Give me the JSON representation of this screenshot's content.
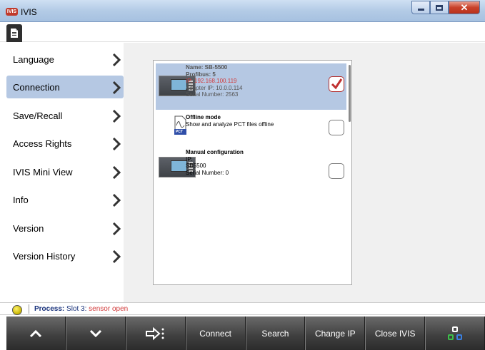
{
  "window": {
    "app_icon_text": "IVIS",
    "title": "IVIS"
  },
  "menubar": {
    "doc_icon": "document-icon"
  },
  "sidebar": {
    "items": [
      {
        "label": "Language"
      },
      {
        "label": "Connection"
      },
      {
        "label": "Save/Recall"
      },
      {
        "label": "Access Rights"
      },
      {
        "label": "IVIS Mini View"
      },
      {
        "label": "Info"
      },
      {
        "label": "Version"
      },
      {
        "label": "Version History"
      }
    ],
    "active_index": 1
  },
  "connection_list": {
    "items": [
      {
        "name": "Name: SB-5500",
        "profibus": "Profibus: 5",
        "ip": "IP: 192.168.100.119",
        "adapter_ip": "Adapter IP: 10.0.0.114",
        "serial": "Serial Number: 2563",
        "checked": true
      },
      {
        "title": "Offline mode",
        "desc": "Show and analyze PCT files offline",
        "icon_label": "PCT",
        "checked": false
      },
      {
        "title": "Manual configuration",
        "ip": "IP:",
        "model": "SB5500",
        "serial": "Serial Number:  0",
        "checked": false
      }
    ]
  },
  "status": {
    "label": "Process:",
    "slot": "Slot 3:",
    "message": "sensor open",
    "led_color": "#f0e030"
  },
  "toolbar": {
    "buttons": [
      {
        "icon": "chevron-up-icon"
      },
      {
        "icon": "chevron-down-icon"
      },
      {
        "icon": "arrow-right-options-icon"
      },
      {
        "label": "Connect"
      },
      {
        "label": "Search"
      },
      {
        "label": "Change IP"
      },
      {
        "label": "Close IVIS"
      },
      {
        "icon": "network-icon"
      }
    ]
  }
}
